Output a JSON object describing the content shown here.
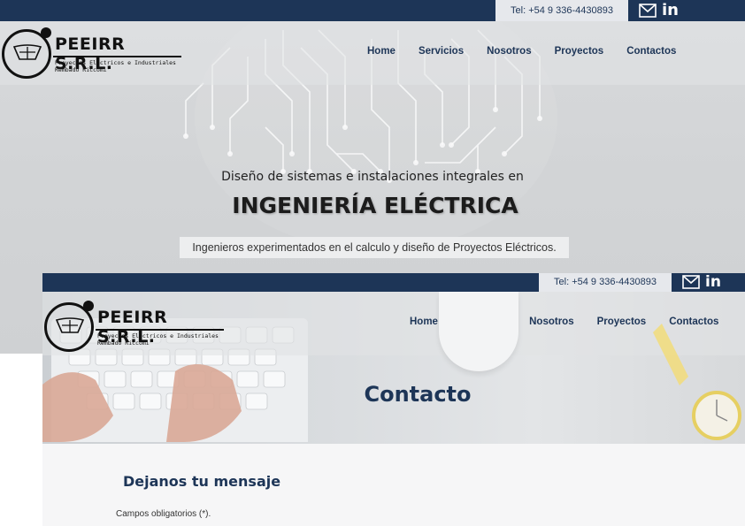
{
  "topbar": {
    "phone": "Tel: +54 9 336-4430893",
    "mail_icon": "envelope-icon",
    "social_icon": "linkedin-icon",
    "social_label": "in"
  },
  "logo": {
    "name": "PEEIRR S.R.L.",
    "tagline": "Proyectos Eléctricos e Industriales",
    "owner": "Rembado Riccomi'"
  },
  "nav": {
    "items": [
      "Home",
      "Servicios",
      "Nosotros",
      "Proyectos",
      "Contactos"
    ]
  },
  "hero": {
    "intro": "Diseño de sistemas e instalaciones integrales en",
    "title": "INGENIERÍA ELÉCTRICA",
    "subtitle": "Ingenieros experimentados en el calculo y diseño de Proyectos Eléctricos."
  },
  "contact_page": {
    "title": "Contacto",
    "form_title": "Dejanos tu mensaje",
    "required_note": "Campos obligatorios (*)."
  },
  "colors": {
    "navy": "#1d3557",
    "light_bar": "#e6e8ec"
  }
}
